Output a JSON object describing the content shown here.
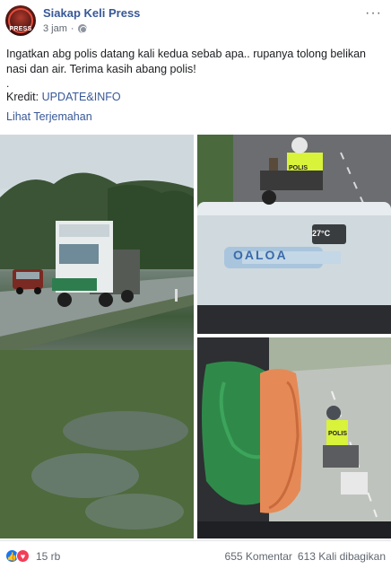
{
  "post": {
    "page_name": "Siakap Keli Press",
    "avatar_text": "PRESS",
    "time": "3 jam",
    "separator": "·",
    "text": "Ingatkan abg polis datang kali kedua sebab apa.. rupanya tolong belikan nasi dan air. Terima kasih abang polis!",
    "dot": ".",
    "credit_label": "Kredit: ",
    "credit_link": "UPDATE&INFO",
    "translate": "Lihat Terjemahan",
    "more": "···"
  },
  "photos": {
    "p2_temp": "27°C",
    "p2_vest": "POLIS",
    "p3_vest": "POLIS",
    "p2_cap": "OALOA"
  },
  "footer": {
    "reaction_count": "15 rb",
    "comments": "655 Komentar",
    "shares": "613 Kali dibagikan"
  },
  "colors": {
    "link": "#385898",
    "like": "#1877f2",
    "love": "#f33e58",
    "vest": "#d9f23a"
  }
}
